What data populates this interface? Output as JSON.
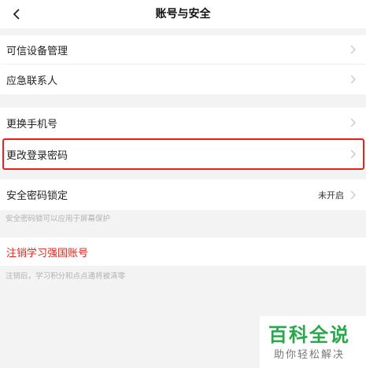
{
  "header": {
    "title": "账号与安全",
    "back_icon": "chevron-left-icon"
  },
  "section1": {
    "items": [
      {
        "label": "可信设备管理"
      },
      {
        "label": "应急联系人"
      }
    ]
  },
  "section2": {
    "items": [
      {
        "label": "更换手机号"
      },
      {
        "label": "更改登录密码"
      }
    ]
  },
  "section3": {
    "label": "安全密码锁定",
    "value": "未开启",
    "note": "安全密码锁可以应用于屏幕保护"
  },
  "section4": {
    "label": "注销学习强国账号",
    "note": "注销后，学习积分和点点通将被清零"
  },
  "watermark": {
    "main": "百科全说",
    "sub": "助你轻松解决"
  },
  "colors": {
    "background": "#f3f3f3",
    "highlight_border": "#e8221b",
    "danger_text": "#e0251f",
    "watermark_green": "#29a84a"
  }
}
